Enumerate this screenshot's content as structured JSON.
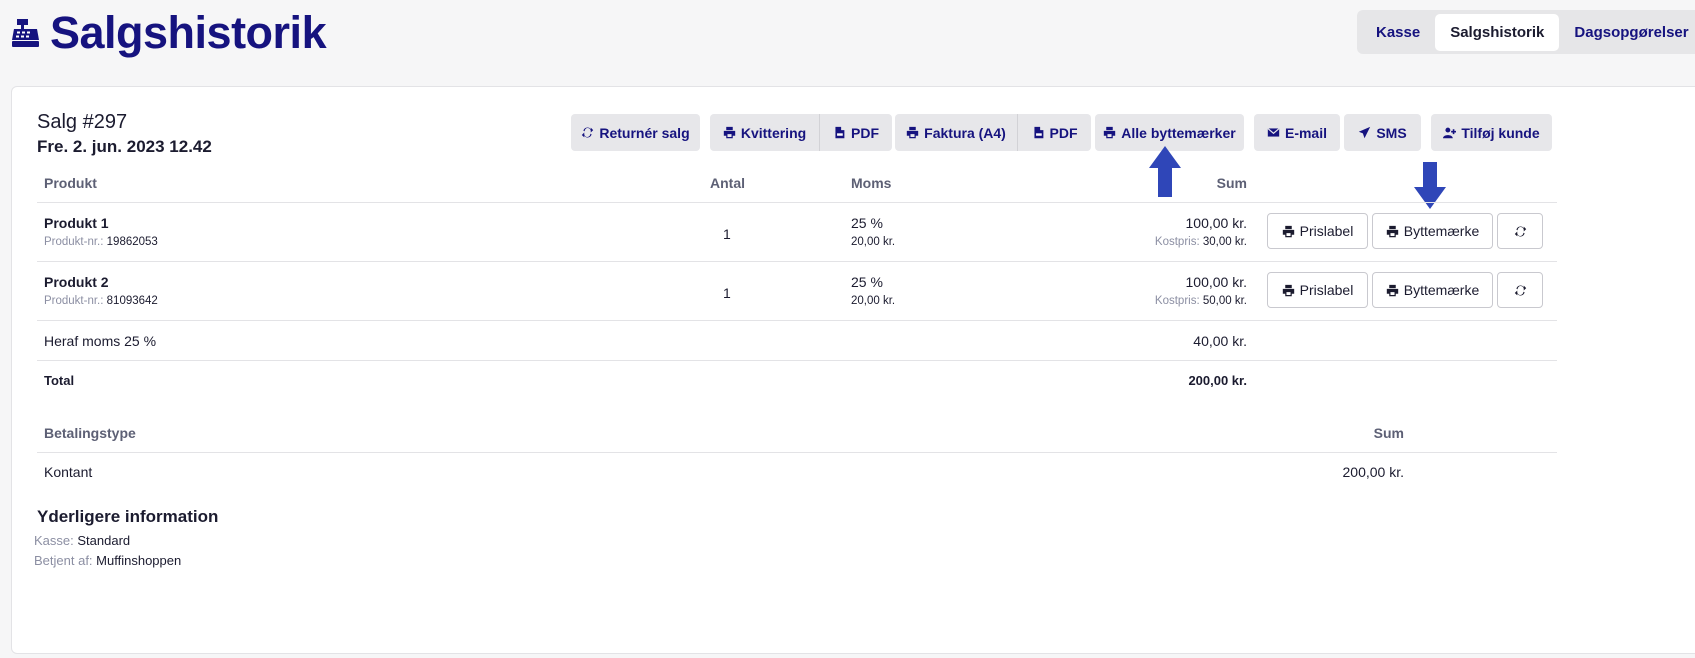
{
  "header": {
    "title": "Salgshistorik"
  },
  "nav": {
    "tabs": [
      "Kasse",
      "Salgshistorik",
      "Dagsopgørelser"
    ]
  },
  "sale": {
    "title": "Salg #297",
    "date": "Fre. 2. jun. 2023 12.42"
  },
  "actions": {
    "return": "Returnér salg",
    "receipt": "Kvittering",
    "receipt_pdf": "PDF",
    "invoice": "Faktura (A4)",
    "invoice_pdf": "PDF",
    "all_exchange": "Alle byttemærker",
    "email": "E-mail",
    "sms": "SMS",
    "add_customer": "Tilføj kunde"
  },
  "table": {
    "headers": {
      "product": "Produkt",
      "qty": "Antal",
      "vat": "Moms",
      "sum": "Sum"
    },
    "rows": [
      {
        "name": "Produkt 1",
        "sku_label": "Produkt-nr.:",
        "sku": "19862053",
        "qty": "1",
        "vat_rate": "25 %",
        "vat_amount": "20,00 kr.",
        "sum": "100,00 kr.",
        "cost_label": "Kostpris:",
        "cost": "30,00 kr."
      },
      {
        "name": "Produkt 2",
        "sku_label": "Produkt-nr.:",
        "sku": "81093642",
        "qty": "1",
        "vat_rate": "25 %",
        "vat_amount": "20,00 kr.",
        "sum": "100,00 kr.",
        "cost_label": "Kostpris:",
        "cost": "50,00 kr."
      }
    ],
    "row_buttons": {
      "price_label": "Prislabel",
      "exchange": "Byttemærke"
    },
    "vat_summary": {
      "label": "Heraf moms 25 %",
      "value": "40,00 kr."
    },
    "total": {
      "label": "Total",
      "value": "200,00 kr."
    }
  },
  "payment": {
    "headers": {
      "type": "Betalingstype",
      "sum": "Sum"
    },
    "rows": [
      {
        "type": "Kontant",
        "sum": "200,00 kr."
      }
    ]
  },
  "info": {
    "title": "Yderligere information",
    "register_label": "Kasse:",
    "register": "Standard",
    "served_label": "Betjent af:",
    "served": "Muffinshoppen"
  },
  "colors": {
    "brand": "#16137f",
    "arrow": "#2f46b8",
    "button_bg": "#e7e7ea"
  },
  "icons": [
    "cash-register-icon",
    "refresh-icon",
    "printer-icon",
    "pdf-file-icon",
    "envelope-icon",
    "paper-plane-icon",
    "user-plus-icon",
    "arrow-up-icon",
    "arrow-down-icon"
  ]
}
